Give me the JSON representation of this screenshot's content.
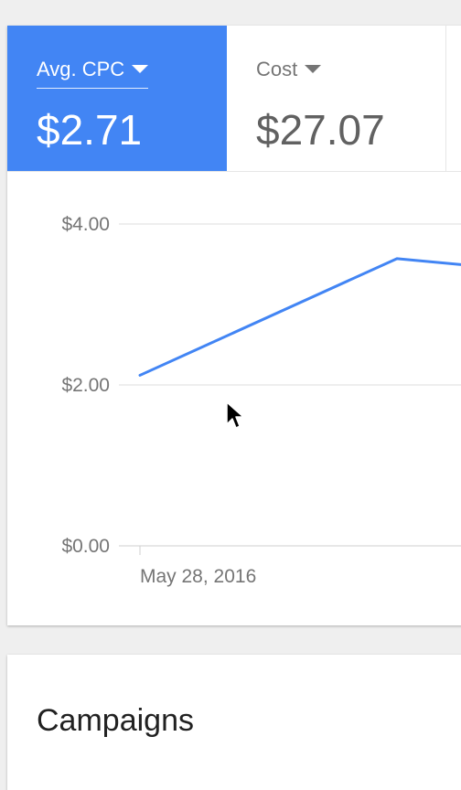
{
  "metrics": {
    "active": {
      "label": "Avg. CPC",
      "value": "$2.71",
      "color": "#4285f4"
    },
    "inactive": {
      "label": "Cost",
      "value": "$27.07"
    }
  },
  "chart_data": {
    "type": "line",
    "title": "",
    "xlabel": "",
    "ylabel": "",
    "ylim": [
      0,
      4
    ],
    "y_ticks": [
      "$4.00",
      "$2.00",
      "$0.00"
    ],
    "y_tick_values": [
      4,
      2,
      0
    ],
    "x_tick_labels": [
      "May 28, 2016"
    ],
    "grid": true,
    "series": [
      {
        "color": "#4285f4",
        "points": [
          {
            "x": "May 28, 2016",
            "y": 2.12
          },
          {
            "x": "",
            "y": 3.57
          },
          {
            "x": "",
            "y": 3.27
          }
        ]
      }
    ]
  },
  "campaigns": {
    "title": "Campaigns"
  }
}
